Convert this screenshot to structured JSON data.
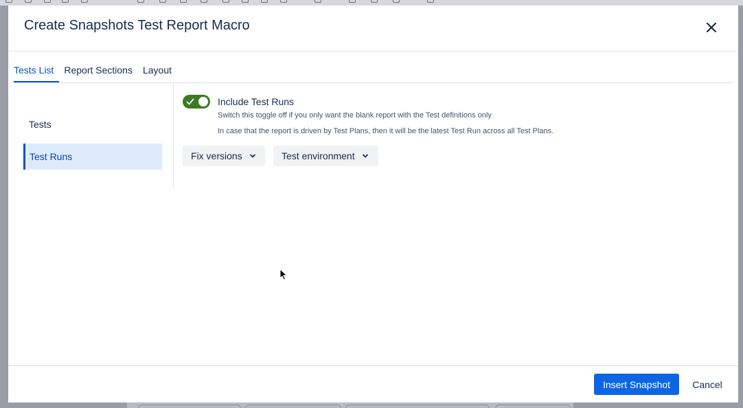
{
  "dialog": {
    "title": "Create Snapshots Test Report Macro"
  },
  "tabs": [
    {
      "label": "Tests List",
      "active": true
    },
    {
      "label": "Report Sections",
      "active": false
    },
    {
      "label": "Layout",
      "active": false
    }
  ],
  "side_nav": [
    {
      "label": "Tests",
      "active": false
    },
    {
      "label": "Test Runs",
      "active": true
    }
  ],
  "include_test_runs": {
    "label": "Include Test Runs",
    "enabled": true,
    "description": "Switch this toggle off if you only want the blank report with the Test definitions only",
    "note": "In case that the report is driven by Test Plans, then it will be the latest Test Run across all Test Plans."
  },
  "filters": [
    {
      "label": "Fix versions",
      "icon": "chevron-down-icon"
    },
    {
      "label": "Test environment",
      "icon": "chevron-down-icon"
    }
  ],
  "footer": {
    "primary_label": "Insert Snapshot",
    "cancel_label": "Cancel"
  },
  "colors": {
    "accent": "#0c66e4",
    "toggle_on": "#3b7a22",
    "nav_active_bg": "#deebff"
  }
}
